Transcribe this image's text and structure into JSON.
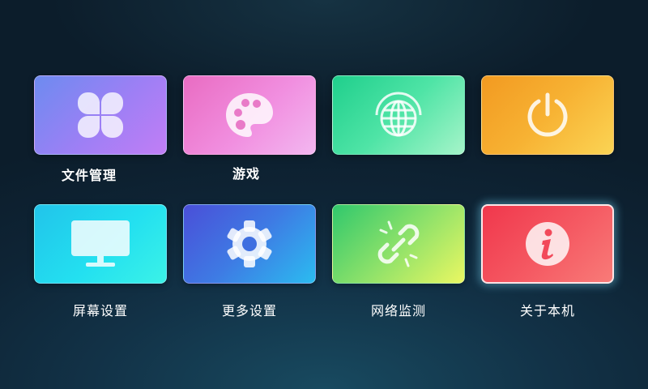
{
  "colors": {
    "background": "#0e2435",
    "text": "#ffffff",
    "focus_glow": "#78dcff"
  },
  "tiles": [
    {
      "label": "文件管理",
      "icon": "clover-icon",
      "accent": "#9e7ff5"
    },
    {
      "label": "游戏",
      "icon": "palette-icon",
      "accent": "#f18fe0"
    },
    {
      "label": "",
      "icon": "globe-icon",
      "accent": "#4fe4a6"
    },
    {
      "label": "",
      "icon": "power-icon",
      "accent": "#f7b233"
    },
    {
      "label": "屏幕设置",
      "icon": "monitor-icon",
      "accent": "#23e0f0"
    },
    {
      "label": "更多设置",
      "icon": "gear-icon",
      "accent": "#3e7be4"
    },
    {
      "label": "网络监测",
      "icon": "broken-link-icon",
      "accent": "#8ce16a"
    },
    {
      "label": "关于本机",
      "icon": "info-icon",
      "accent": "#f55a63",
      "focused": true
    }
  ]
}
